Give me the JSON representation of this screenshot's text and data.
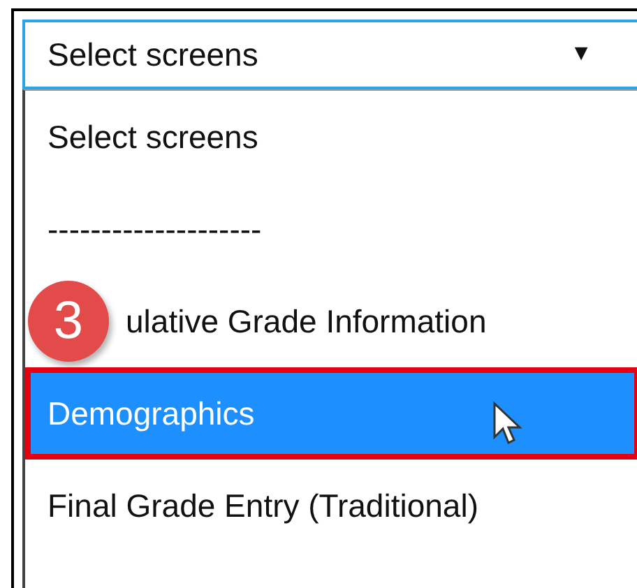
{
  "select": {
    "value": "Select screens",
    "arrow": "▼"
  },
  "options": [
    {
      "label": "Select screens",
      "selected": false
    },
    {
      "label": "--------------------",
      "selected": false
    },
    {
      "label": "ulative Grade Information",
      "selected": false,
      "badge": "3"
    },
    {
      "label": "Demographics",
      "selected": true
    },
    {
      "label": "Final Grade Entry (Traditional)",
      "selected": false
    }
  ]
}
